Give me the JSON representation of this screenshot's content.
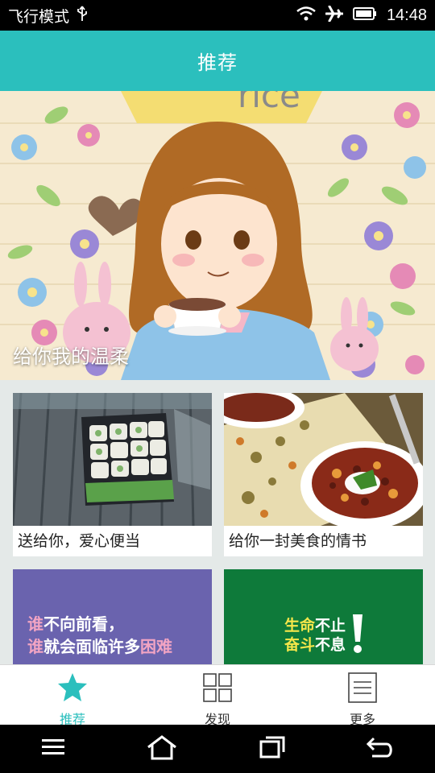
{
  "status_bar": {
    "airplane_mode": "飞行模式",
    "time": "14:48",
    "icons": [
      "usb-icon",
      "wifi-icon",
      "airplane-icon",
      "battery-icon"
    ]
  },
  "header": {
    "title": "推荐"
  },
  "banner": {
    "caption": "给你我的温柔",
    "lettering": "rice"
  },
  "cards": [
    {
      "title": "送给你，爱心便当",
      "image": "sushi-box-photo"
    },
    {
      "title": "给你一封美食的情书",
      "image": "bean-chili-bowl-photo"
    },
    {
      "title": "",
      "image": "quote-card",
      "line1_em": "谁",
      "line1": "不向前看，",
      "line2_em1": "谁",
      "line2_mid": "就会面临许多",
      "line2_em2": "困难"
    },
    {
      "title": "",
      "image": "motto-card",
      "line1_em": "生命",
      "line1": "不止",
      "line2_em": "奋斗",
      "line2": "不息"
    }
  ],
  "tabs": [
    {
      "label": "推荐",
      "icon": "star-icon",
      "active": true
    },
    {
      "label": "发现",
      "icon": "grid-icon",
      "active": false
    },
    {
      "label": "更多",
      "icon": "list-icon",
      "active": false
    }
  ],
  "nav_bar": {
    "icons": [
      "menu-icon",
      "home-icon",
      "recent-apps-icon",
      "back-icon"
    ]
  },
  "colors": {
    "accent": "#2bbfbd",
    "quote_bg": "#6a63ae",
    "motto_bg": "#0e7a3a"
  }
}
